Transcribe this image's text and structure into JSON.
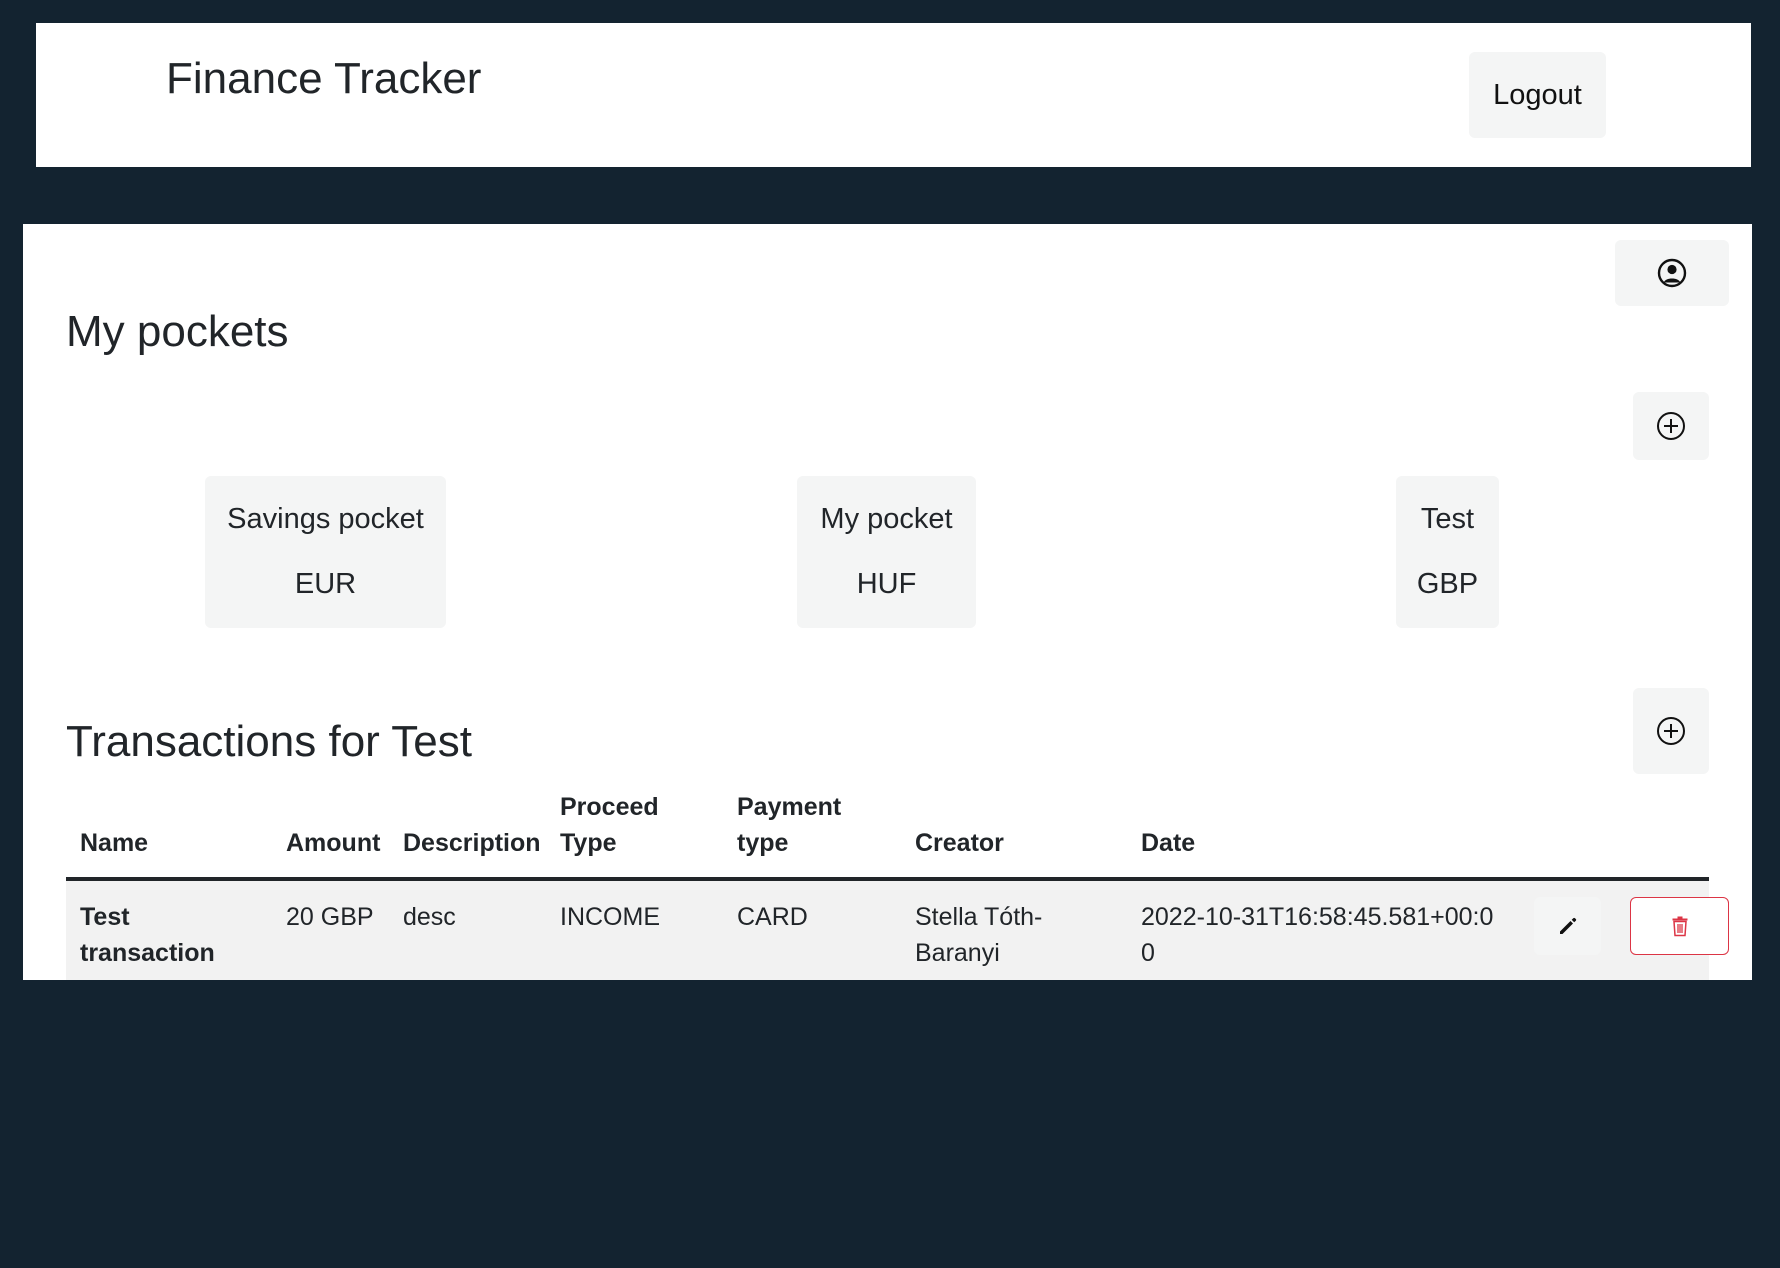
{
  "header": {
    "title": "Finance Tracker",
    "logout_label": "Logout"
  },
  "pockets": {
    "title": "My pockets",
    "items": [
      {
        "name": "Savings pocket",
        "currency": "EUR"
      },
      {
        "name": "My pocket",
        "currency": "HUF"
      },
      {
        "name": "Test",
        "currency": "GBP"
      }
    ]
  },
  "transactions": {
    "title": "Transactions for Test",
    "columns": {
      "name": "Name",
      "amount": "Amount",
      "description": "Description",
      "proceed_type": "Proceed Type",
      "payment_type": "Payment type",
      "creator": "Creator",
      "date": "Date"
    },
    "rows": [
      {
        "name": "Test transaction",
        "amount": "20 GBP",
        "description": "desc",
        "proceed_type": "INCOME",
        "payment_type": "CARD",
        "creator": "Stella Tóth-Baranyi",
        "date": "2022-10-31T16:58:45.581+00:00"
      }
    ]
  },
  "icons": {
    "profile": "user-circle-icon",
    "add": "plus-circle-icon",
    "edit": "pencil-icon",
    "delete": "trash-icon"
  },
  "colors": {
    "background": "#132330",
    "danger": "#dc3545",
    "button_light": "#f4f5f5"
  }
}
